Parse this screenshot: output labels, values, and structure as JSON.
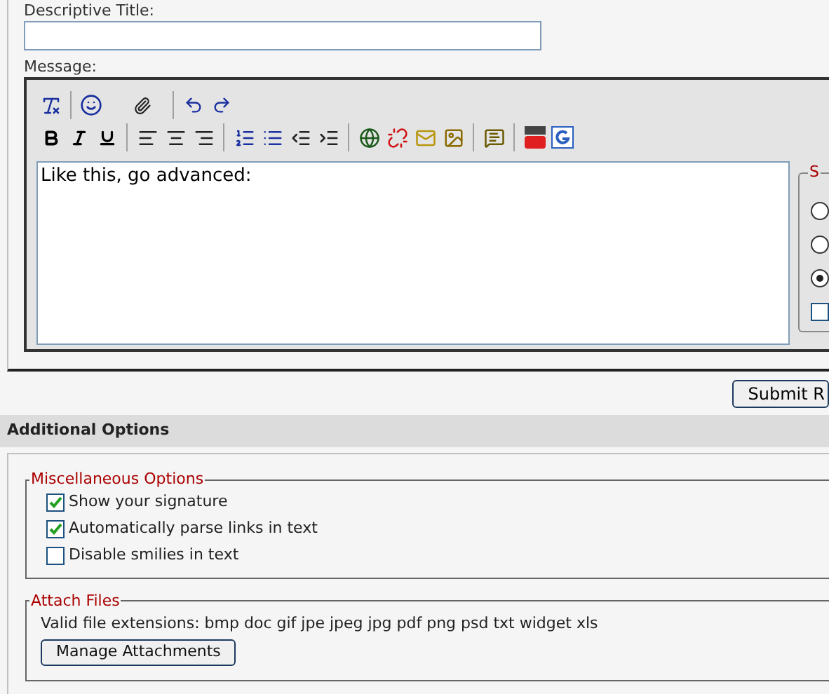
{
  "title_field": {
    "label": "Descriptive Title:"
  },
  "message": {
    "label": "Message:",
    "text": "Like this, go advanced:"
  },
  "side_options": {
    "legend": "S",
    "radios": [
      {
        "selected": false
      },
      {
        "selected": false
      },
      {
        "selected": true
      }
    ],
    "checkbox": {
      "checked": false
    }
  },
  "submit_button": "Submit R",
  "additional_options": {
    "header": "Additional Options",
    "misc": {
      "legend": "Miscellaneous Options",
      "options": [
        {
          "label": "Show your signature",
          "checked": true
        },
        {
          "label": "Automatically parse links in text",
          "checked": true
        },
        {
          "label": "Disable smilies in text",
          "checked": false
        }
      ]
    },
    "attach": {
      "legend": "Attach Files",
      "extensions": "Valid file extensions: bmp doc gif jpe jpeg jpg pdf png psd txt widget xls",
      "button": "Manage Attachments"
    }
  }
}
